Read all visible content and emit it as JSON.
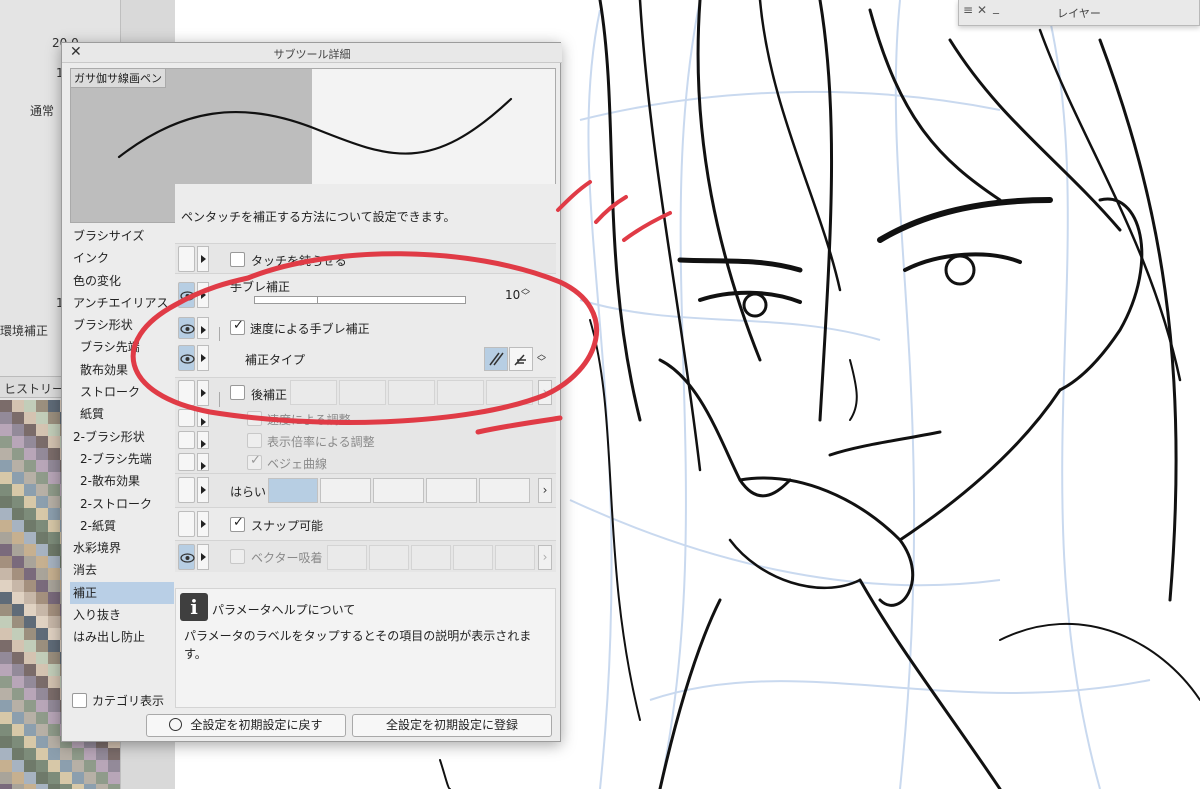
{
  "background": {
    "left_panel": {
      "value_top": "20.0",
      "value_2": "1",
      "blend_mode": "通常",
      "value_3": "1",
      "env_label": "環境補正",
      "history_label": "ヒストリー"
    },
    "layer_window": {
      "title": "レイヤー",
      "menu_icon": "≡",
      "close_icon": "✕",
      "min_icon": "_"
    }
  },
  "window": {
    "title": "サブツール詳細",
    "close_label": "✕",
    "preview_name": "ガサ伽サ線画ペン",
    "description": "ペンタッチを補正する方法について設定できます。",
    "categories": [
      {
        "label": "ブラシサイズ",
        "sub": false
      },
      {
        "label": "インク",
        "sub": false
      },
      {
        "label": "色の変化",
        "sub": false
      },
      {
        "label": "アンチエイリアス",
        "sub": false
      },
      {
        "label": "ブラシ形状",
        "sub": false
      },
      {
        "label": "ブラシ先端",
        "sub": true
      },
      {
        "label": "散布効果",
        "sub": true
      },
      {
        "label": "ストローク",
        "sub": true
      },
      {
        "label": "紙質",
        "sub": true
      },
      {
        "label": "2-ブラシ形状",
        "sub": false
      },
      {
        "label": "2-ブラシ先端",
        "sub": true
      },
      {
        "label": "2-散布効果",
        "sub": true
      },
      {
        "label": "2-ストローク",
        "sub": true
      },
      {
        "label": "2-紙質",
        "sub": true
      },
      {
        "label": "水彩境界",
        "sub": false
      },
      {
        "label": "消去",
        "sub": false
      },
      {
        "label": "補正",
        "sub": false,
        "selected": true
      },
      {
        "label": "入り抜き",
        "sub": false
      },
      {
        "label": "はみ出し防止",
        "sub": false
      }
    ],
    "category_show_label": "カテゴリ表示",
    "settings": {
      "row1_label": "タッチを鈍らせる",
      "stabilization_label": "手ブレ補正",
      "stabilization_value": "10",
      "stabilization_level": 0.3,
      "speed_stabilization_label": "速度による手ブレ補正",
      "speed_stabilization_checked": "✓",
      "correction_type_label": "補正タイプ",
      "post_correction_label": "後補正",
      "speed_adjust_label": "速度による調整",
      "zoom_adjust_label": "表示倍率による調整",
      "bezier_label": "ベジェ曲線",
      "bezier_check": "✓",
      "harai_label": "はらい",
      "snap_label": "スナップ可能",
      "snap_checked": "✓",
      "vector_snap_label": "ベクター吸着"
    },
    "help": {
      "icon": "i",
      "title": "パラメータヘルプについて",
      "body": "パラメータのラベルをタップするとその項目の説明が表示されます。"
    },
    "buttons": {
      "reset_label": "全設定を初期設定に戻す",
      "register_label": "全設定を初期設定に登録"
    }
  },
  "colors": {
    "annotation_red": "#e03b46",
    "selected_blue": "#b9cfe6",
    "window_bg": "#ececec"
  }
}
